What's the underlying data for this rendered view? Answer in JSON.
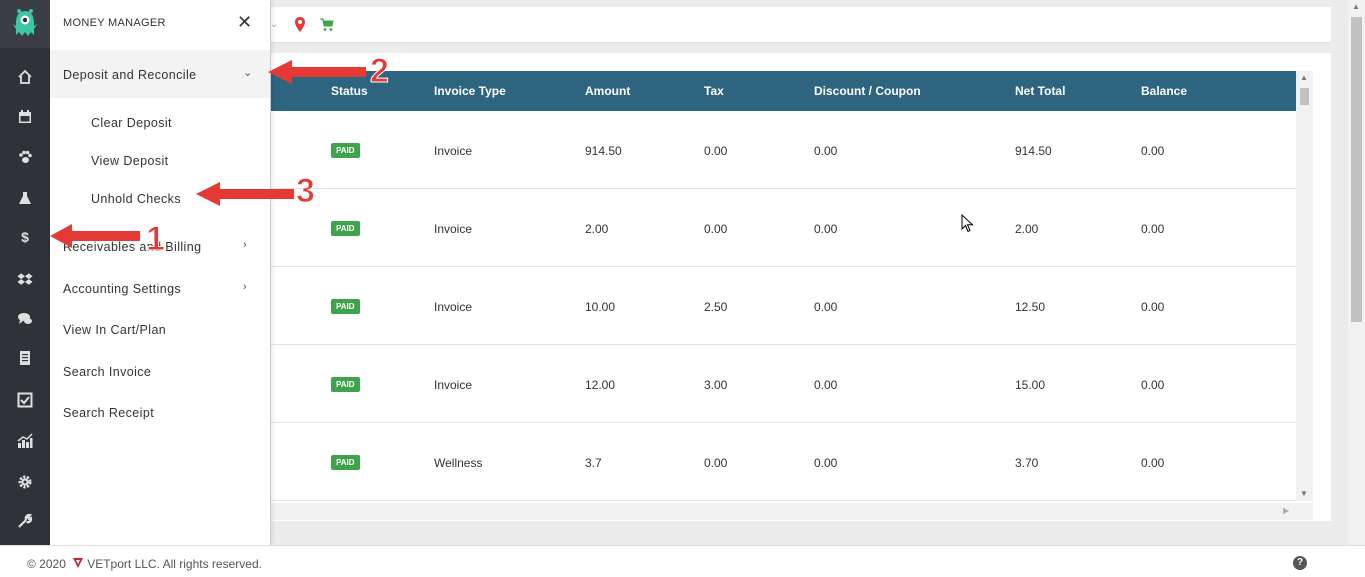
{
  "flyout": {
    "title": "MONEY MANAGER",
    "close_symbol": "✕",
    "items": [
      {
        "label": "Deposit and Reconcile",
        "expanded": true
      },
      {
        "label": "Clear Deposit"
      },
      {
        "label": "View Deposit"
      },
      {
        "label": "Unhold Checks"
      },
      {
        "label": "Receivables and Billing"
      },
      {
        "label": "Accounting Settings"
      },
      {
        "label": "View In Cart/Plan"
      },
      {
        "label": "Search Invoice"
      },
      {
        "label": "Search Receipt"
      }
    ]
  },
  "annotations": [
    "1",
    "2",
    "3"
  ],
  "table": {
    "headers": [
      "Status",
      "Invoice Type",
      "Amount",
      "Tax",
      "Discount / Coupon",
      "Net Total",
      "Balance"
    ],
    "rows": [
      {
        "status": "PAID",
        "type": "Invoice",
        "amount": "914.50",
        "tax": "0.00",
        "discount": "0.00",
        "net": "914.50",
        "balance": "0.00"
      },
      {
        "status": "PAID",
        "type": "Invoice",
        "amount": "2.00",
        "tax": "0.00",
        "discount": "0.00",
        "net": "2.00",
        "balance": "0.00"
      },
      {
        "status": "PAID",
        "type": "Invoice",
        "amount": "10.00",
        "tax": "2.50",
        "discount": "0.00",
        "net": "12.50",
        "balance": "0.00"
      },
      {
        "status": "PAID",
        "type": "Invoice",
        "amount": "12.00",
        "tax": "3.00",
        "discount": "0.00",
        "net": "15.00",
        "balance": "0.00"
      },
      {
        "status": "PAID",
        "type": "Wellness",
        "amount": "3.7",
        "tax": "0.00",
        "discount": "0.00",
        "net": "3.70",
        "balance": "0.00"
      }
    ]
  },
  "footer": {
    "copyright": "© 2020",
    "company": "VETport LLC. All rights reserved.",
    "help": "?"
  },
  "rail_icons": [
    "home-icon",
    "calendar-icon",
    "paw-icon",
    "flask-icon",
    "dollar-icon",
    "dropbox-icon",
    "chat-icon",
    "receipt-icon",
    "checkbox-icon",
    "chart-icon",
    "gear-icon",
    "wrench-icon"
  ],
  "colors": {
    "rail": "#2f3237",
    "table_header": "#2d6480",
    "paid_badge": "#3ea34a",
    "annotation": "#e53935",
    "logo": "#3cc6a6"
  }
}
